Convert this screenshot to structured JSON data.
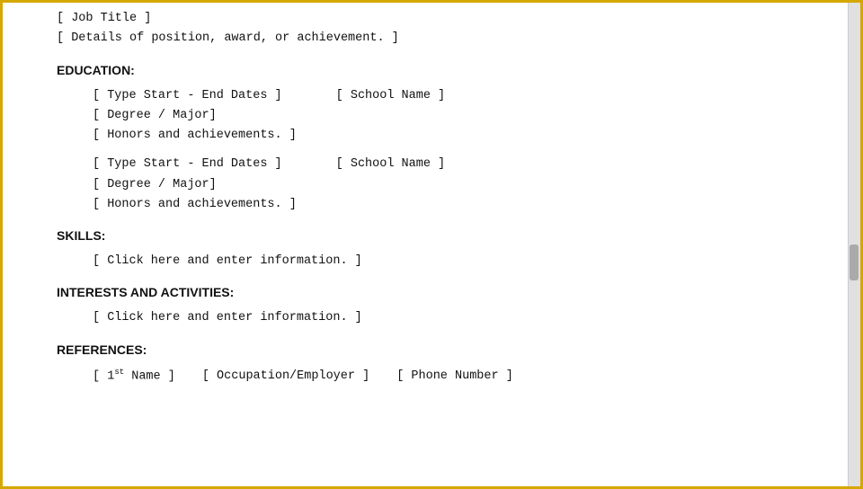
{
  "document": {
    "top_fields": {
      "job_title": "[ Job Title ]",
      "details": "[  Details of position, award, or achievement.  ]"
    },
    "education": {
      "heading": "EDUCATION:",
      "entries": [
        {
          "dates_field": "[  Type Start - End Dates  ]",
          "school_field": "[  School  Name  ]",
          "degree_field": "[  Degree / Major]",
          "honors_field": "[  Honors and achievements.  ]"
        },
        {
          "dates_field": "[  Type Start - End Dates  ]",
          "school_field": "[  School  Name  ]",
          "degree_field": "[  Degree / Major]",
          "honors_field": "[  Honors and achievements.  ]"
        }
      ]
    },
    "skills": {
      "heading": "SKILLS:",
      "entry": "[  Click here and enter information.  ]"
    },
    "interests": {
      "heading": "INTERESTS AND ACTIVITIES:",
      "entry": "[  Click here and enter information.  ]"
    },
    "references": {
      "heading": "REFERENCES:",
      "row": {
        "name_field": "[ 1st Name ]",
        "occupation_field": "[ Occupation/Employer ]",
        "phone_field": "[ Phone Number ]"
      }
    }
  }
}
